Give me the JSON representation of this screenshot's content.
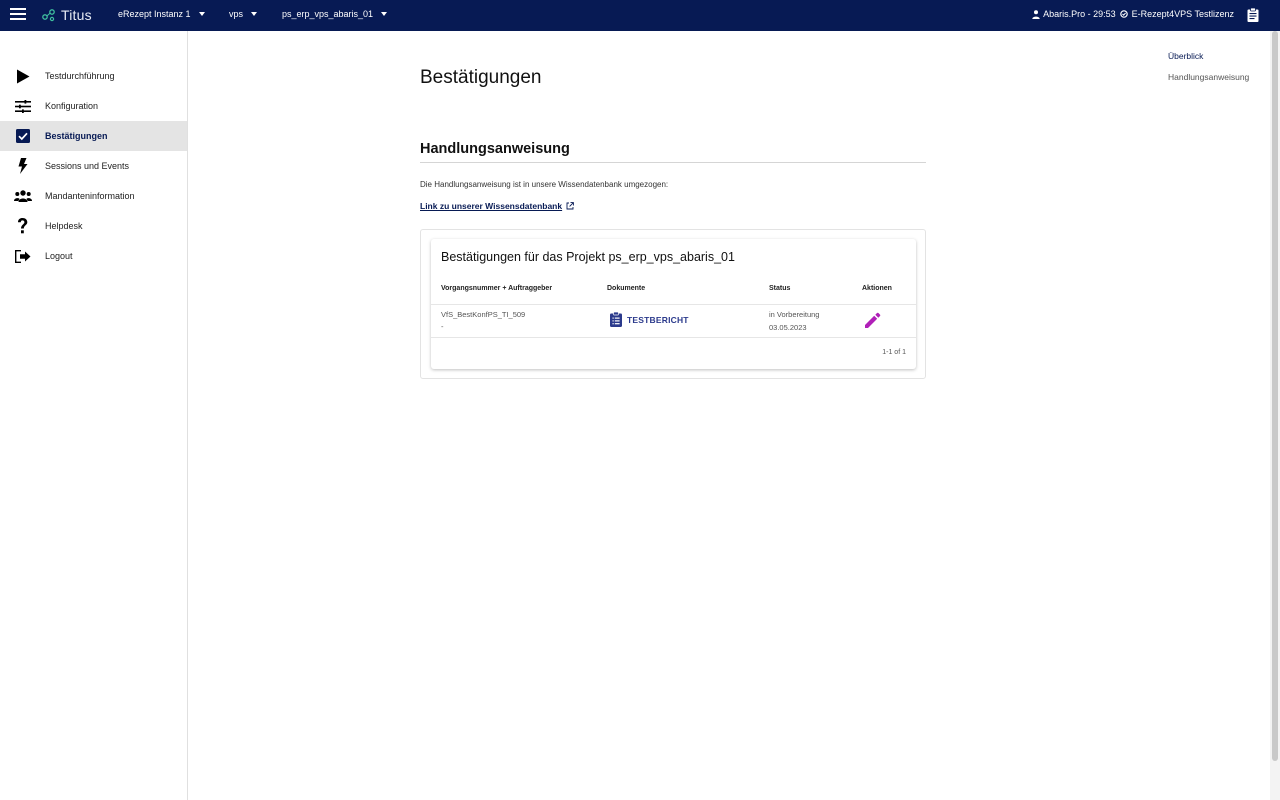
{
  "topbar": {
    "app_name": "Titus",
    "instance": "eRezept Instanz 1",
    "product": "vps",
    "project": "ps_erp_vps_abaris_01",
    "user_session": "Abaris.Pro - 29:53",
    "license": "E-Rezept4VPS Testlizenz",
    "background_color": "#071a54"
  },
  "sidebar": {
    "items": [
      {
        "label": "Testdurchführung",
        "icon": "play-icon"
      },
      {
        "label": "Konfiguration",
        "icon": "tune-icon"
      },
      {
        "label": "Bestätigungen",
        "icon": "checkbox-icon",
        "active": true
      },
      {
        "label": "Sessions und Events",
        "icon": "bolt-icon"
      },
      {
        "label": "Mandanteninformation",
        "icon": "people-icon"
      },
      {
        "label": "Helpdesk",
        "icon": "question-icon"
      },
      {
        "label": "Logout",
        "icon": "logout-icon"
      }
    ]
  },
  "main": {
    "page_title": "Bestätigungen",
    "section_title": "Handlungsanweisung",
    "info_text": "Die Handlungsanweisung ist in unsere Wissendatenbank umgezogen:",
    "kb_link": "Link zu unserer Wissensdatenbank",
    "card": {
      "title": "Bestätigungen für das Projekt ps_erp_vps_abaris_01",
      "columns": [
        "Vorgangsnummer + Auftraggeber",
        "Dokumente",
        "Status",
        "Aktionen"
      ],
      "rows": [
        {
          "vorgangsnummer": "VfS_BestKonfPS_TI_509",
          "auftraggeber": "-",
          "dokument": "TESTBERICHT",
          "status": "in Vorbereitung",
          "datum": "03.05.2023"
        }
      ],
      "pagination": "1-1 of 1"
    }
  },
  "toc": {
    "items": [
      "Überblick",
      "Handlungsanweisung"
    ]
  },
  "colors": {
    "accent": "#071a54",
    "edit_icon": "#b020b8",
    "doc_icon": "#2b3a8c"
  }
}
